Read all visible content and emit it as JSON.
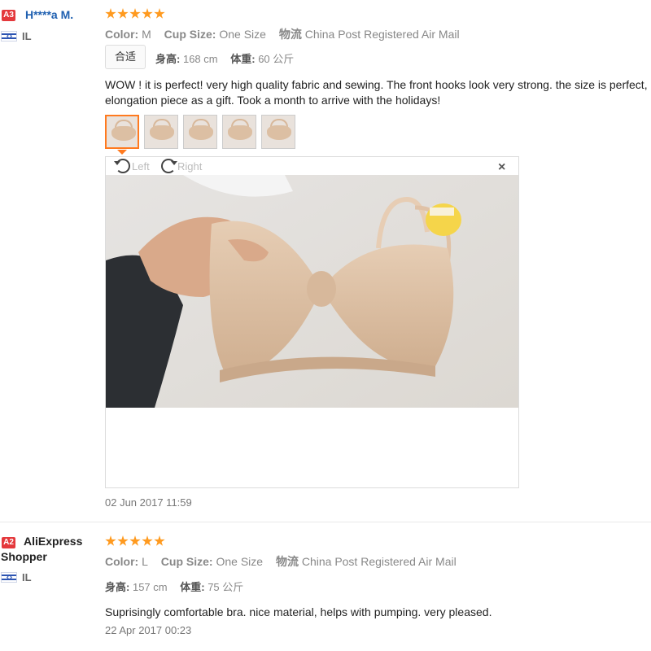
{
  "reviews": [
    {
      "badge": "A3",
      "buyer_name": "H****a M.",
      "country_code": "IL",
      "rating": 5,
      "attributes": [
        {
          "key": "Color:",
          "value": "M"
        },
        {
          "key": "Cup Size:",
          "value": "One Size"
        },
        {
          "key": "物流",
          "value": "China Post Registered Air Mail"
        }
      ],
      "fit_label": "合适",
      "height_key": "身高:",
      "height_val": "168 cm",
      "weight_key": "体重:",
      "weight_val": "60 公斤",
      "text_line1": "WOW ! it is perfect! very high quality fabric and sewing. The front hooks look very strong. the size is perfect,",
      "text_line2": "elongation piece as a gift. Took a month to arrive with the holidays!",
      "viewer": {
        "rotate_left_label": "Left",
        "rotate_right_label": "Right",
        "close_label": "×"
      },
      "date": "02 Jun 2017 11:59"
    },
    {
      "badge": "A2",
      "buyer_name_line1": "AliExpress",
      "buyer_name_line2": "Shopper",
      "country_code": "IL",
      "rating": 5,
      "attributes": [
        {
          "key": "Color:",
          "value": "L"
        },
        {
          "key": "Cup Size:",
          "value": "One Size"
        },
        {
          "key": "物流",
          "value": "China Post Registered Air Mail"
        }
      ],
      "height_key": "身高:",
      "height_val": "157 cm",
      "weight_key": "体重:",
      "weight_val": "75 公斤",
      "text": "Suprisingly comfortable bra. nice material, helps with pumping. very pleased.",
      "date": "22 Apr 2017 00:23"
    }
  ],
  "colors": {
    "badge": "#e4393c",
    "star": "#ff9a1f",
    "name_link": "#1e5fb0",
    "thumb_active": "#ff7a1f"
  }
}
